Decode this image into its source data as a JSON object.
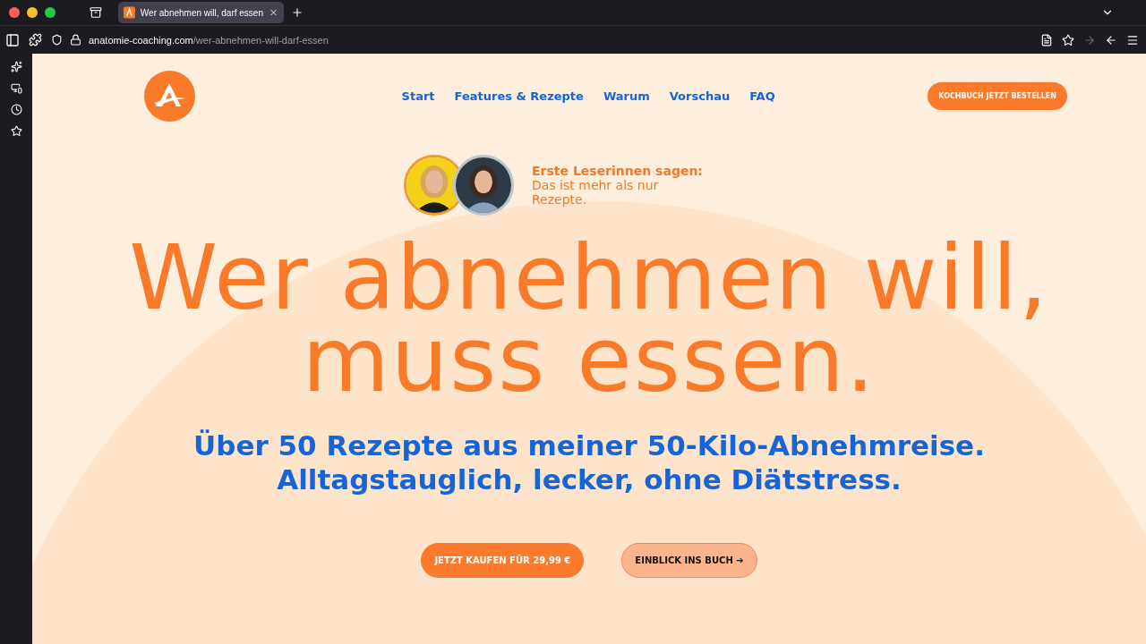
{
  "browser": {
    "tab": {
      "title": "Wer abnehmen will, darf essen",
      "selected": true
    },
    "url": {
      "domain": "anatomie-coaching.com",
      "path": "/wer-abnehmen-will-darf-essen"
    }
  },
  "nav": {
    "links": [
      "Start",
      "Features & Rezepte",
      "Warum",
      "Vorschau",
      "FAQ"
    ],
    "cta": "KOCHBUCH JETZT BESTELLEN"
  },
  "testimonial": {
    "heading": "Erste Leserinnen sagen:",
    "quote": "Das ist mehr als nur Rezepte."
  },
  "hero": {
    "headline": [
      "Wer abnehmen will,",
      "muss essen."
    ],
    "subheadline": [
      "Über 50 Rezepte aus meiner 50-Kilo-Abnehmreise.",
      "Alltagstauglich, lecker, ohne Diätstress."
    ]
  },
  "buttons": [
    {
      "label": "JETZT KAUFEN FÜR 29,99 €",
      "kind": "primary"
    },
    {
      "label": "EINBLICK INS BUCH ➔",
      "kind": "secondary"
    }
  ]
}
